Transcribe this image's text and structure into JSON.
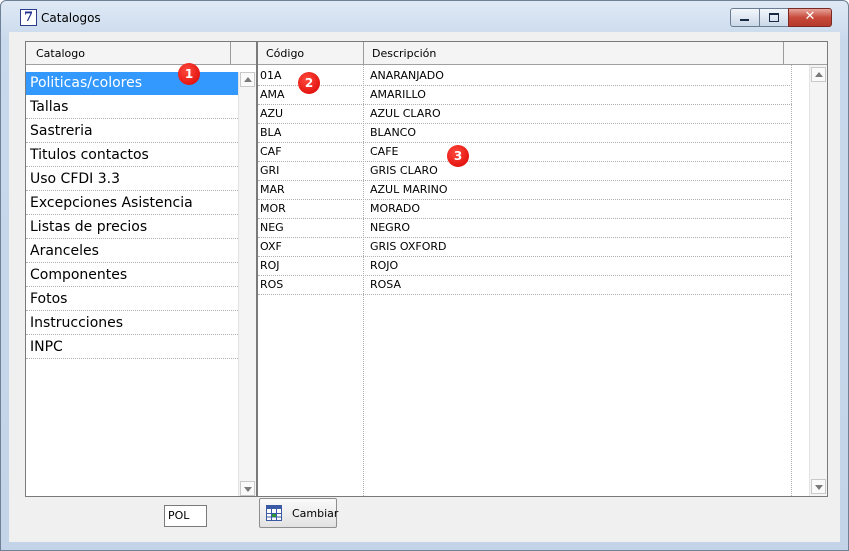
{
  "window": {
    "title": "Catalogos",
    "icon": "7"
  },
  "controls": {
    "minimize": "minimize-icon",
    "maximize": "maximize-icon",
    "close_glyph": "✕"
  },
  "left": {
    "header": "Catalogo",
    "items": [
      "Politicas/colores",
      "Tallas",
      "Sastreria",
      "Titulos contactos",
      "Uso CFDI 3.3",
      "Excepciones Asistencia",
      "Listas de precios",
      "Aranceles",
      "Componentes",
      "Fotos",
      "Instrucciones",
      "INPC"
    ],
    "selected_index": 0,
    "code_value": "POL"
  },
  "grid": {
    "columns": [
      "Código",
      "Descripción"
    ],
    "rows": [
      [
        "01A",
        "ANARANJADO"
      ],
      [
        "AMA",
        "AMARILLO"
      ],
      [
        "AZU",
        "AZUL CLARO"
      ],
      [
        "BLA",
        "BLANCO"
      ],
      [
        "CAF",
        "CAFE"
      ],
      [
        "GRI",
        "GRIS CLARO"
      ],
      [
        "MAR",
        "AZUL MARINO"
      ],
      [
        "MOR",
        "MORADO"
      ],
      [
        "NEG",
        "NEGRO"
      ],
      [
        "OXF",
        "GRIS OXFORD"
      ],
      [
        "ROJ",
        "ROJO"
      ],
      [
        "ROS",
        "ROSA"
      ]
    ]
  },
  "buttons": {
    "cambiar": "Cambiar"
  },
  "markers": [
    "1",
    "2",
    "3"
  ],
  "colors": {
    "selection": "#3399ff",
    "marker": "#d90000"
  }
}
